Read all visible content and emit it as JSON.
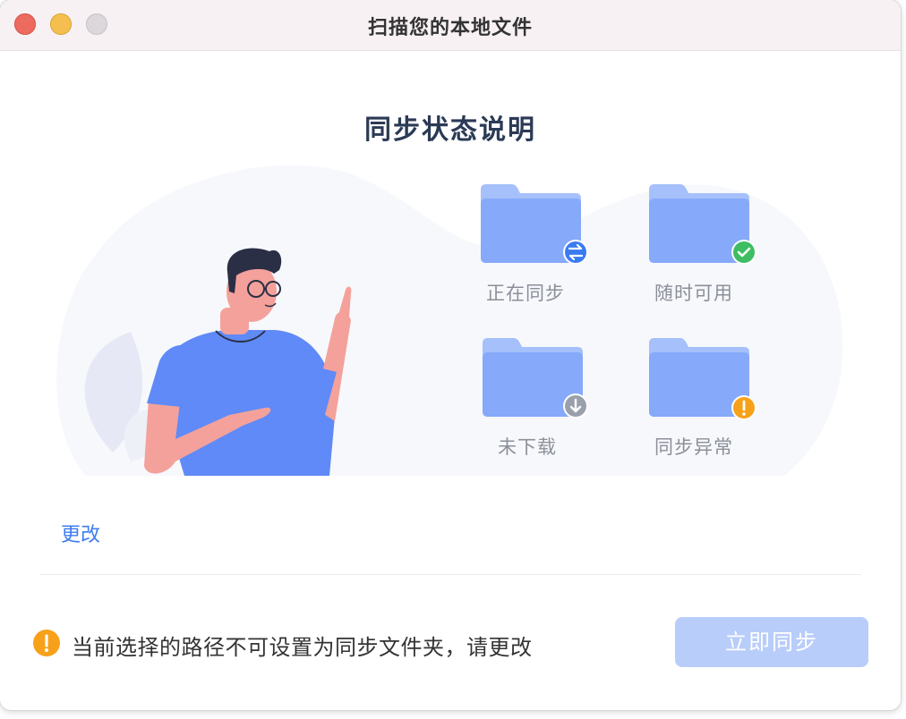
{
  "window": {
    "title": "扫描您的本地文件"
  },
  "heading": "同步状态说明",
  "status_items": [
    {
      "label": "正在同步",
      "icon": "sync-arrows-icon",
      "badge_color": "#3a7bf2"
    },
    {
      "label": "随时可用",
      "icon": "check-icon",
      "badge_color": "#3ebd62"
    },
    {
      "label": "未下载",
      "icon": "download-arrow-icon",
      "badge_color": "#9aa0ab"
    },
    {
      "label": "同步异常",
      "icon": "exclamation-icon",
      "badge_color": "#f7a11a"
    }
  ],
  "change_link": "更改",
  "warning": {
    "text": "当前选择的路径不可设置为同步文件夹，请更改",
    "icon": "warning-icon",
    "color": "#f7a11a"
  },
  "sync_button": {
    "label": "立即同步",
    "disabled": true
  },
  "colors": {
    "accent": "#3d7cf0",
    "folder": "#8fb2fb",
    "button_disabled": "#b8cdfa"
  }
}
